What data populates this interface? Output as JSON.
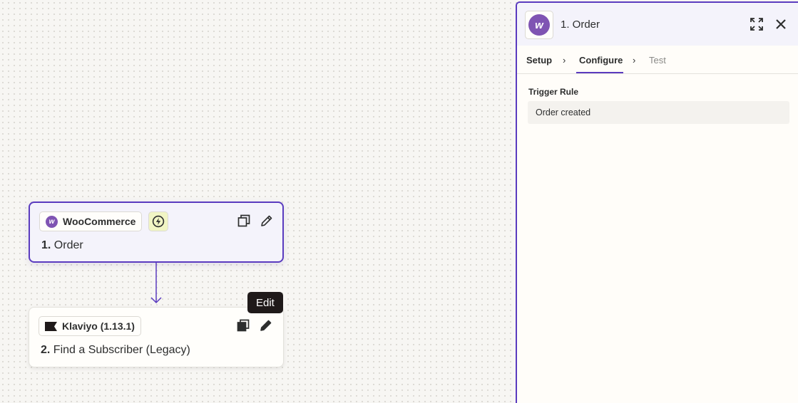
{
  "canvas": {
    "trigger_step": {
      "app_name": "WooCommerce",
      "app_logo_letter": "w",
      "step_number": "1.",
      "step_title": "Order",
      "icons": [
        "bolt-icon",
        "duplicate-icon",
        "pencil-icon"
      ]
    },
    "action_step": {
      "app_name": "Klaviyo (1.13.1)",
      "step_number": "2.",
      "step_title": "Find a Subscriber (Legacy)",
      "icons": [
        "flag-icon",
        "duplicate-icon",
        "pencil-icon"
      ]
    },
    "tooltip": "Edit"
  },
  "panel": {
    "logo_letter": "w",
    "title": "1. Order",
    "icons": [
      "expand-icon",
      "close-icon"
    ],
    "tabs": [
      {
        "label": "Setup",
        "state": "completed"
      },
      {
        "label": "Configure",
        "state": "active"
      },
      {
        "label": "Test",
        "state": "inactive"
      }
    ],
    "separator": "›",
    "field": {
      "label": "Trigger Rule",
      "value": "Order created"
    }
  },
  "colors": {
    "accent": "#5a3bbf",
    "woo_purple": "#7f54b3",
    "tooltip_bg": "#1f1a1a",
    "bolt_bg": "#f1f5c4"
  }
}
